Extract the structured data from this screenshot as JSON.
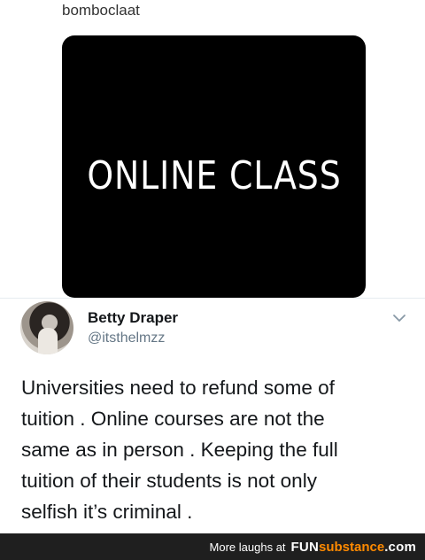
{
  "quoted": {
    "text": "bomboclaat"
  },
  "media": {
    "text": "ONLINE CLASS"
  },
  "tweet": {
    "display_name": "Betty Draper",
    "handle": "@itsthelmzz",
    "body": "Universities need to refund some of\ntuition . Online courses are not the\nsame as in person . Keeping the full\ntuition of their students is not only\nselfish it’s criminal ."
  },
  "icons": {
    "more": "chevron-down-icon"
  },
  "footer": {
    "label": "More laughs at",
    "brand_prefix": "FUN",
    "brand_suffix": "substance",
    "brand_domain": ".com"
  },
  "colors": {
    "footer_bg": "#1f1f1f",
    "brand_accent": "#ff8a00",
    "handle_gray": "#657786"
  }
}
